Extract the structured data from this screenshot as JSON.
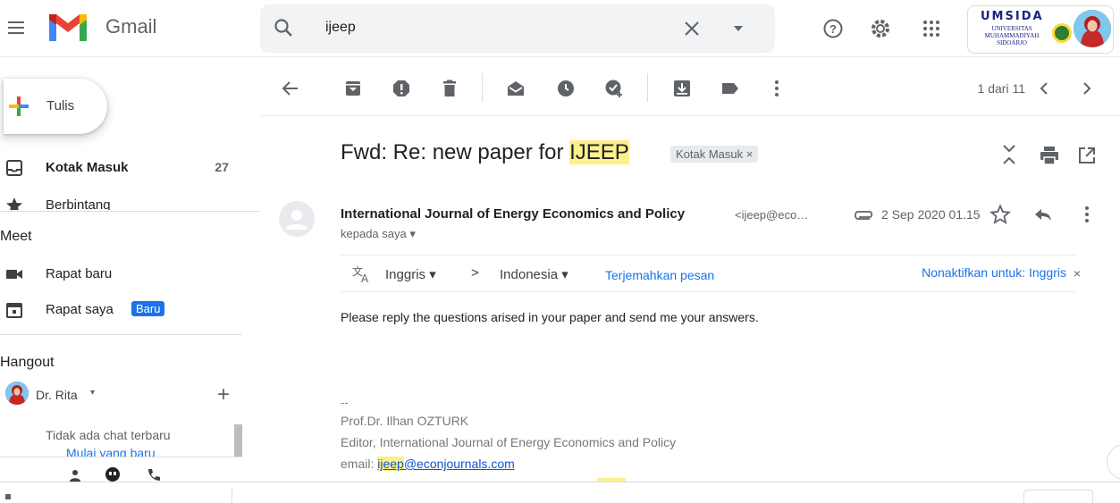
{
  "header": {
    "app_name": "Gmail",
    "search": {
      "value": "ijeep"
    },
    "account": {
      "org_word": "UMSIDA",
      "org_sub": "UNIVERSITAS MUHAMMADIYAH SIDOARJO"
    }
  },
  "sidebar": {
    "compose_label": "Tulis",
    "items": [
      {
        "label": "Kotak Masuk",
        "count": "27"
      },
      {
        "label": "Berbintang"
      }
    ],
    "meet": {
      "heading": "Meet",
      "new_meeting": "Rapat baru",
      "my_meetings": "Rapat saya",
      "new_badge": "Baru"
    },
    "hangout": {
      "heading": "Hangout",
      "user_name": "Dr. Rita",
      "no_chats": "Tidak ada chat terbaru",
      "start_new": "Mulai yang baru"
    }
  },
  "toolbar": {
    "pagination": "1 dari 11"
  },
  "email": {
    "subject_prefix": "Fwd: Re: new paper for ",
    "subject_highlight": "IJEEP",
    "label_chip": "Kotak Masuk ×",
    "sender_name": "International Journal of Energy Economics and Policy",
    "sender_email": "<ijeep@eco…",
    "date": "2 Sep 2020 01.15",
    "to_me": "kepada saya ▾",
    "translate": {
      "from_lang": "Inggris ▾",
      "arrow": ">",
      "to_lang": "Indonesia ▾",
      "translate_link": "Terjemahkan pesan",
      "disable": "Nonaktifkan untuk: Inggris"
    },
    "body": "Please reply the questions arised in your paper and send me your answers.",
    "signature": {
      "dashes": "--",
      "name": "Prof.Dr. Ilhan OZTURK",
      "role": "Editor, International Journal of Energy Economics and Policy",
      "email_label": "email: ",
      "email_highlight": "ijeep",
      "email_rest": "@econjournals.com"
    }
  },
  "colors": {
    "accent_blue": "#1a73e8",
    "highlight_yellow": "#fdf08c",
    "gmail_red": "#ea4335",
    "text_grey": "#5f6368"
  }
}
